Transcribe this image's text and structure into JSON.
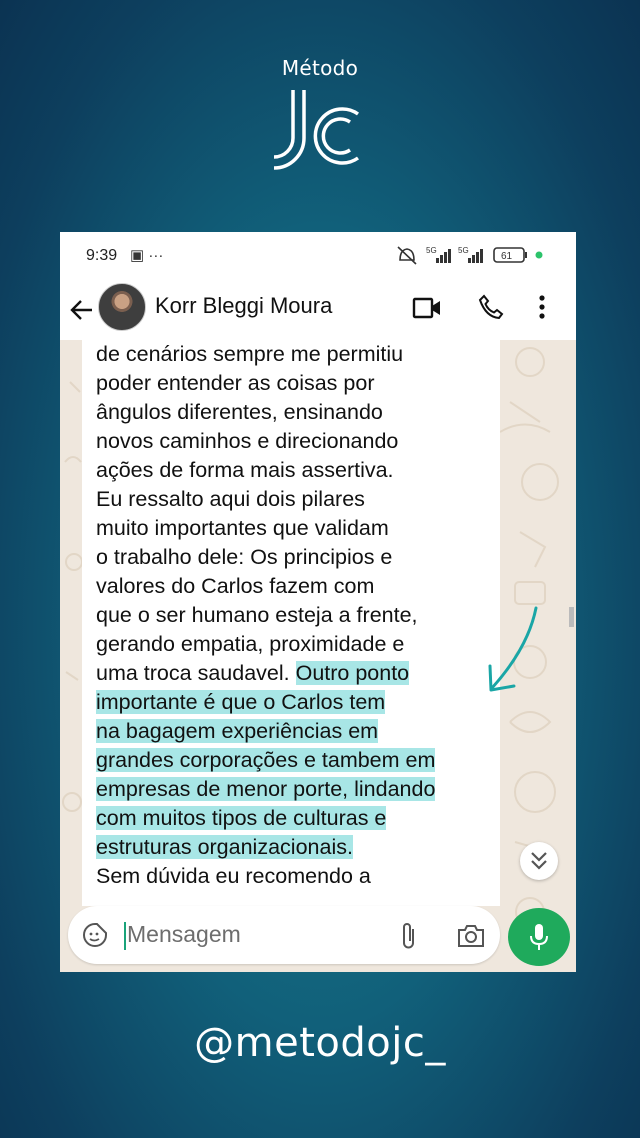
{
  "brand": {
    "method_label": "Método",
    "logo_text": "JC",
    "handle": "@metodojc_"
  },
  "status_bar": {
    "time": "9:39",
    "network1": "5G",
    "network2": "5G",
    "battery": "61"
  },
  "chat": {
    "contact_name": "Korr Bleggi Moura",
    "message_lines": [
      {
        "pre": "de cenários sempre me permitiu",
        "hl": ""
      },
      {
        "pre": "poder entender as coisas por",
        "hl": ""
      },
      {
        "pre": "ângulos diferentes, ensinando",
        "hl": ""
      },
      {
        "pre": "novos caminhos e direcionando",
        "hl": ""
      },
      {
        "pre": "ações de forma mais assertiva.",
        "hl": ""
      },
      {
        "pre": "Eu ressalto aqui dois pilares",
        "hl": ""
      },
      {
        "pre": "muito importantes que validam",
        "hl": ""
      },
      {
        "pre": "o trabalho dele: Os principios e",
        "hl": ""
      },
      {
        "pre": "valores do Carlos fazem com",
        "hl": ""
      },
      {
        "pre": "que o ser humano esteja a frente,",
        "hl": ""
      },
      {
        "pre": "gerando empatia, proximidade e",
        "hl": ""
      },
      {
        "pre": "uma troca saudavel. ",
        "hl": "Outro ponto"
      },
      {
        "pre": "",
        "hl": "importante é que o Carlos tem"
      },
      {
        "pre": "",
        "hl": "na bagagem experiências em"
      },
      {
        "pre": "",
        "hl": "grandes corporações e tambem em"
      },
      {
        "pre": "",
        "hl": "empresas de menor porte, lindando"
      },
      {
        "pre": "",
        "hl": "com muitos tipos de culturas e"
      },
      {
        "pre": "",
        "hl": "estruturas organizacionais."
      },
      {
        "pre": "Sem dúvida eu recomendo a",
        "hl": ""
      }
    ]
  },
  "input": {
    "placeholder": "Mensagem"
  },
  "colors": {
    "highlight": "#a8e6e6",
    "annotation_arrow": "#1aa6a6",
    "mic_button": "#1faa5c"
  },
  "icons": [
    "back-arrow-icon",
    "video-call-icon",
    "phone-call-icon",
    "more-vert-icon",
    "sticker-icon",
    "attach-icon",
    "camera-icon",
    "mic-icon",
    "chevron-double-down-icon"
  ]
}
